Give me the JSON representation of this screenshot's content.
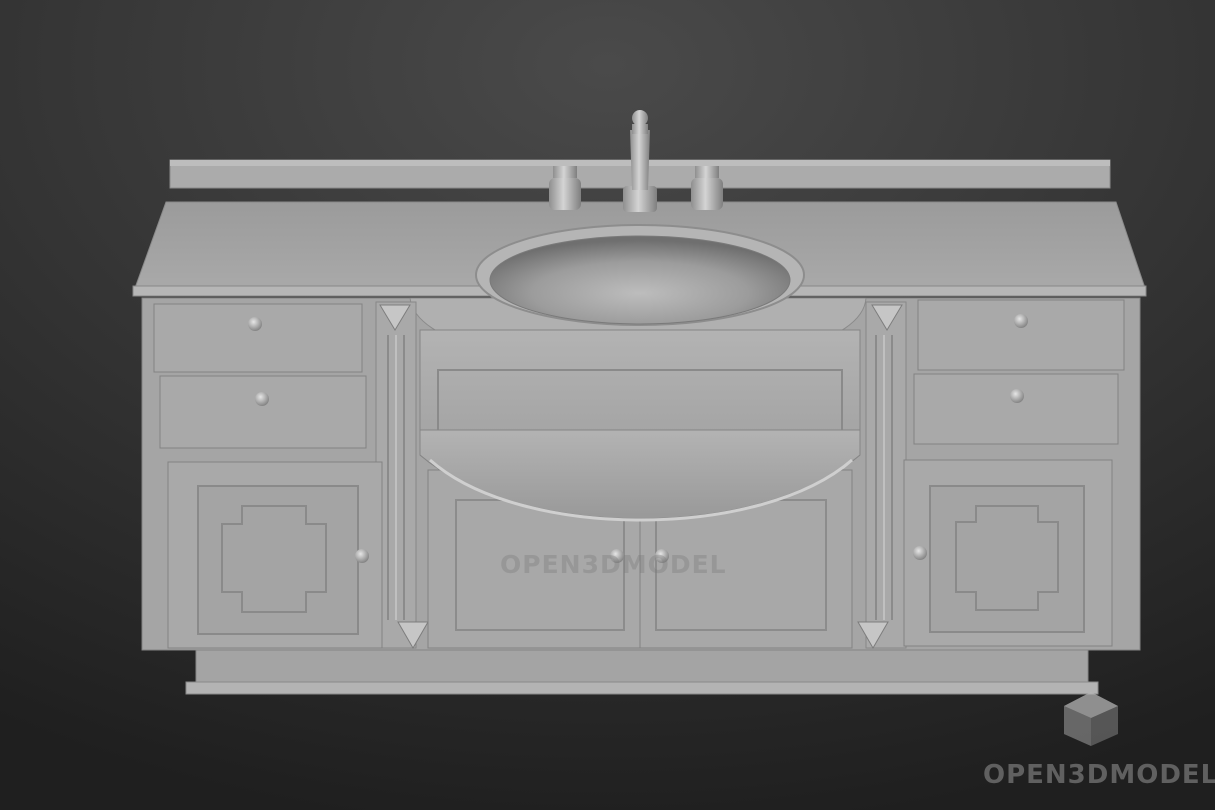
{
  "scene": {
    "subject": "bathroom vanity with sink",
    "background_color": "#2b2b2b",
    "model_color": "#a6a6a6"
  },
  "watermarks": {
    "center_text": "OPEN3DMODEL",
    "corner_text": "OPEN3DMODEL",
    "logo_icon": "cube-logo-icon"
  }
}
